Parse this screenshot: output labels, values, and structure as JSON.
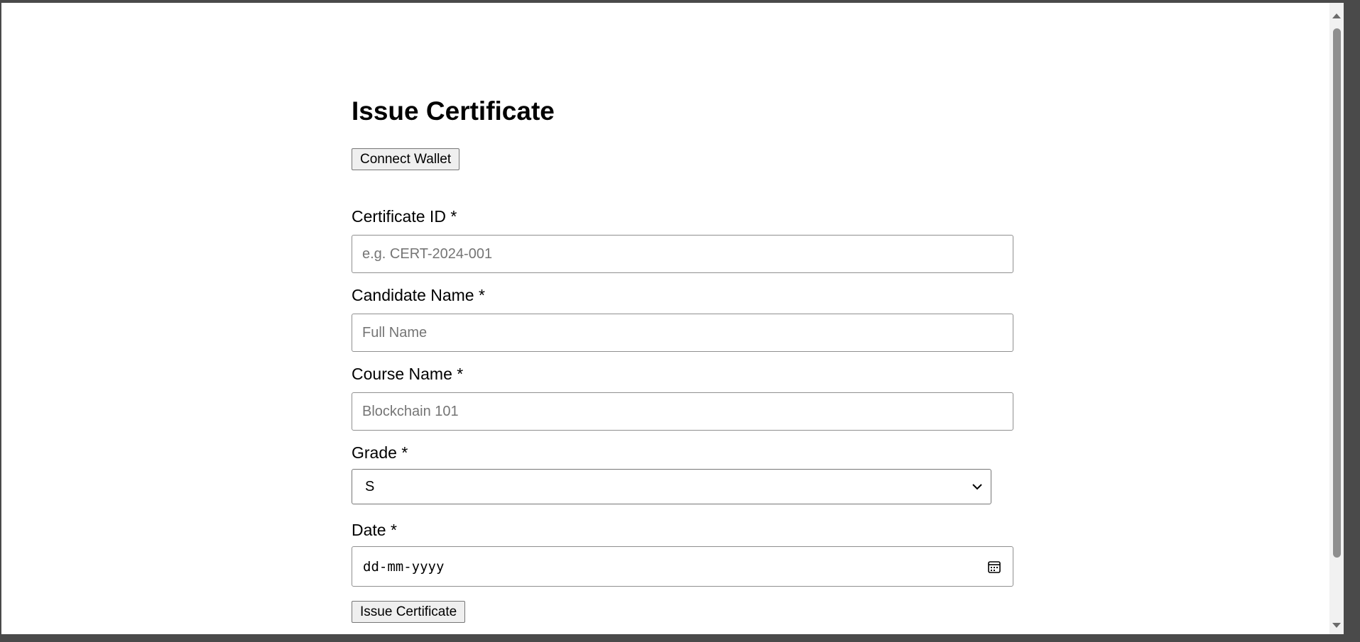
{
  "header": {
    "title": "Issue Certificate"
  },
  "wallet": {
    "connect_label": "Connect Wallet"
  },
  "form": {
    "certificate_id": {
      "label": "Certificate ID *",
      "placeholder": "e.g. CERT-2024-001",
      "value": ""
    },
    "candidate_name": {
      "label": "Candidate Name *",
      "placeholder": "Full Name",
      "value": ""
    },
    "course_name": {
      "label": "Course Name *",
      "placeholder": "Blockchain 101",
      "value": ""
    },
    "grade": {
      "label": "Grade *",
      "selected": "S"
    },
    "date": {
      "label": "Date *",
      "placeholder": "dd-mm-yyyy"
    },
    "submit_label": "Issue Certificate"
  },
  "icons": {
    "grade_dropdown": "chevron-down-icon",
    "date_picker": "calendar-icon",
    "scroll_up": "triangle-up-icon",
    "scroll_down": "triangle-down-icon"
  }
}
